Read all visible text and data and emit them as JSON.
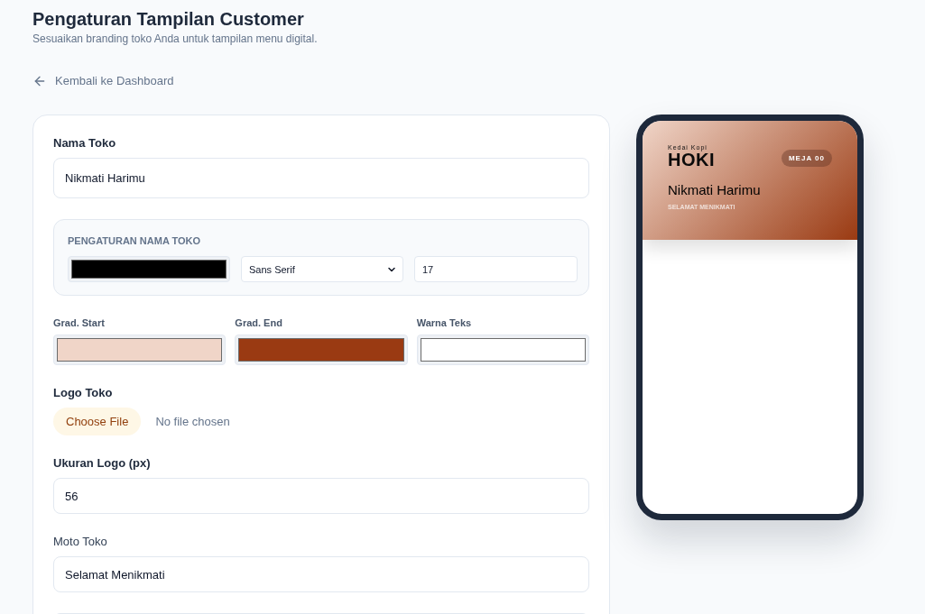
{
  "header": {
    "title": "Pengaturan Tampilan Customer",
    "subtitle": "Sesuaikan branding toko Anda untuk tampilan menu digital."
  },
  "back_link": {
    "label": "Kembali ke Dashboard"
  },
  "form": {
    "store_name": {
      "label": "Nama Toko",
      "value": "Nikmati Harimu"
    },
    "name_settings": {
      "heading": "PENGATURAN NAMA TOKO",
      "color": "#000000",
      "font": "Sans Serif",
      "size": "17"
    },
    "color_fields": [
      {
        "label": "Grad. Start",
        "color": "#f0d5c8"
      },
      {
        "label": "Grad. End",
        "color": "#9a3a12"
      },
      {
        "label": "Warna Teks",
        "color": "#ffffff"
      }
    ],
    "logo": {
      "label": "Logo Toko",
      "button": "Choose File",
      "status": "No file chosen"
    },
    "logo_size": {
      "label": "Ukuran Logo (px)",
      "value": "56"
    },
    "motto": {
      "label": "Moto Toko",
      "value": "Selamat Menikmati"
    }
  },
  "preview": {
    "logo_tagline": "Kedai Kopi",
    "logo_name": "HOKI",
    "table_badge": "MEJA 00",
    "store_name": "Nikmati Harimu",
    "motto": "SELAMAT MENIKMATI"
  }
}
